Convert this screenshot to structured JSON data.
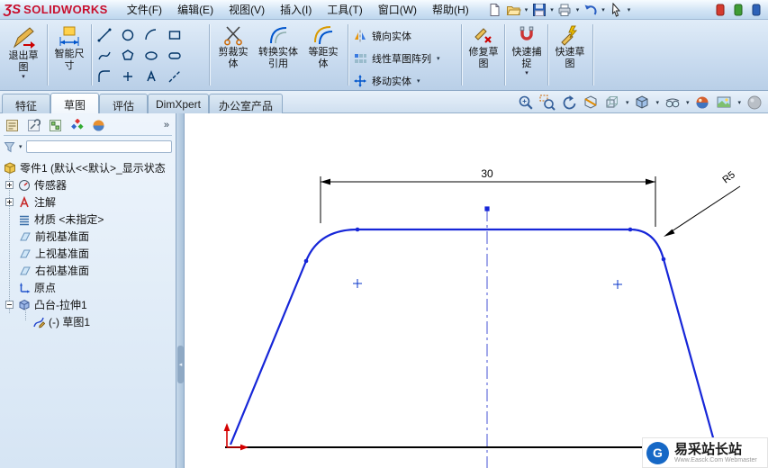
{
  "titlebar": {
    "logo_mark": "ƷS",
    "logo_text": "SOLIDWORKS",
    "menus": [
      "文件(F)",
      "编辑(E)",
      "视图(V)",
      "插入(I)",
      "工具(T)",
      "窗口(W)",
      "帮助(H)"
    ]
  },
  "ribbon": {
    "exit_sketch": "退出草图",
    "smart_dimension": "智能尺寸",
    "trim": "剪裁实体",
    "convert": "转换实体引用",
    "offset": "等距实体",
    "mirror": "镜向实体",
    "linear_pattern": "线性草图阵列",
    "move": "移动实体",
    "repair": "修复草图",
    "quick_snap": "快速捕捉",
    "quick_sketch": "快速草图"
  },
  "tabs": [
    "特征",
    "草图",
    "评估",
    "DimXpert",
    "办公室产品"
  ],
  "tree": {
    "root": "零件1 (默认<<默认>_显示状态",
    "items": [
      "传感器",
      "注解",
      "材质 <未指定>",
      "前视基准面",
      "上视基准面",
      "右视基准面",
      "原点",
      "凸台-拉伸1",
      "(-) 草图1"
    ]
  },
  "sketch": {
    "dimension": "30",
    "radius": "R5"
  },
  "watermark": {
    "logo_letter": "G",
    "title": "易采站长站",
    "subtitle": "Www.Easck.Com Webmaster"
  }
}
